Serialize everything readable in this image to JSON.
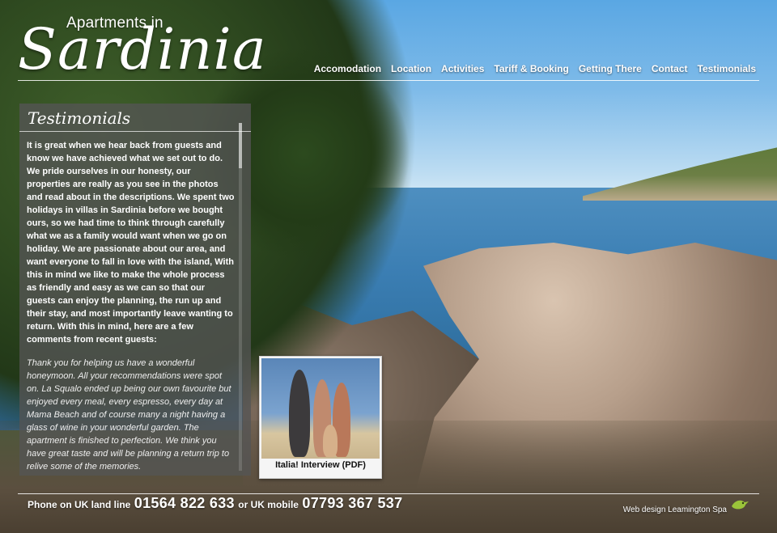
{
  "logo": {
    "small": "Apartments in",
    "big": "Sardinia"
  },
  "nav": [
    {
      "label": "Accomodation"
    },
    {
      "label": "Location"
    },
    {
      "label": "Activities"
    },
    {
      "label": "Tariff & Booking"
    },
    {
      "label": "Getting There"
    },
    {
      "label": "Contact"
    },
    {
      "label": "Testimonials"
    }
  ],
  "panel": {
    "title": "Testimonials",
    "intro": "It is great when we hear back from guests and know we have achieved what we set out to do. We pride ourselves in our honesty, our properties are really as you see in the photos and read about in the descriptions. We spent two holidays in villas in Sardinia before we bought ours, so we had time to think through carefully what we as a family would want when we go on holiday. We are passionate about our area, and want everyone to fall in love with the island, With this in mind we like to make the whole process as friendly and easy as we can so that our guests can enjoy the planning, the run up and their stay, and most importantly leave wanting to return. With this in mind, here are a few comments from recent guests:",
    "quote": "Thank you for helping us have a wonderful honeymoon. All your recommendations were spot on. La Squalo ended up being our own favourite but enjoyed every meal, every espresso, every day at Mama Beach and of course many a night having a glass of wine in your wonderful garden. The apartment is finished to perfection. We think you have great taste and will be planning a return trip to relive some of the memories."
  },
  "interview": {
    "caption": "Italia! Interview (PDF)"
  },
  "footer": {
    "landline_label": "Phone on UK land line",
    "landline_number": "01564 822 633",
    "mobile_label": "or UK mobile",
    "mobile_number": "07793 367 537",
    "credit": "Web design Leamington Spa"
  },
  "colors": {
    "accent_bird": "#9bc43a",
    "panel_bg": "#555555"
  }
}
